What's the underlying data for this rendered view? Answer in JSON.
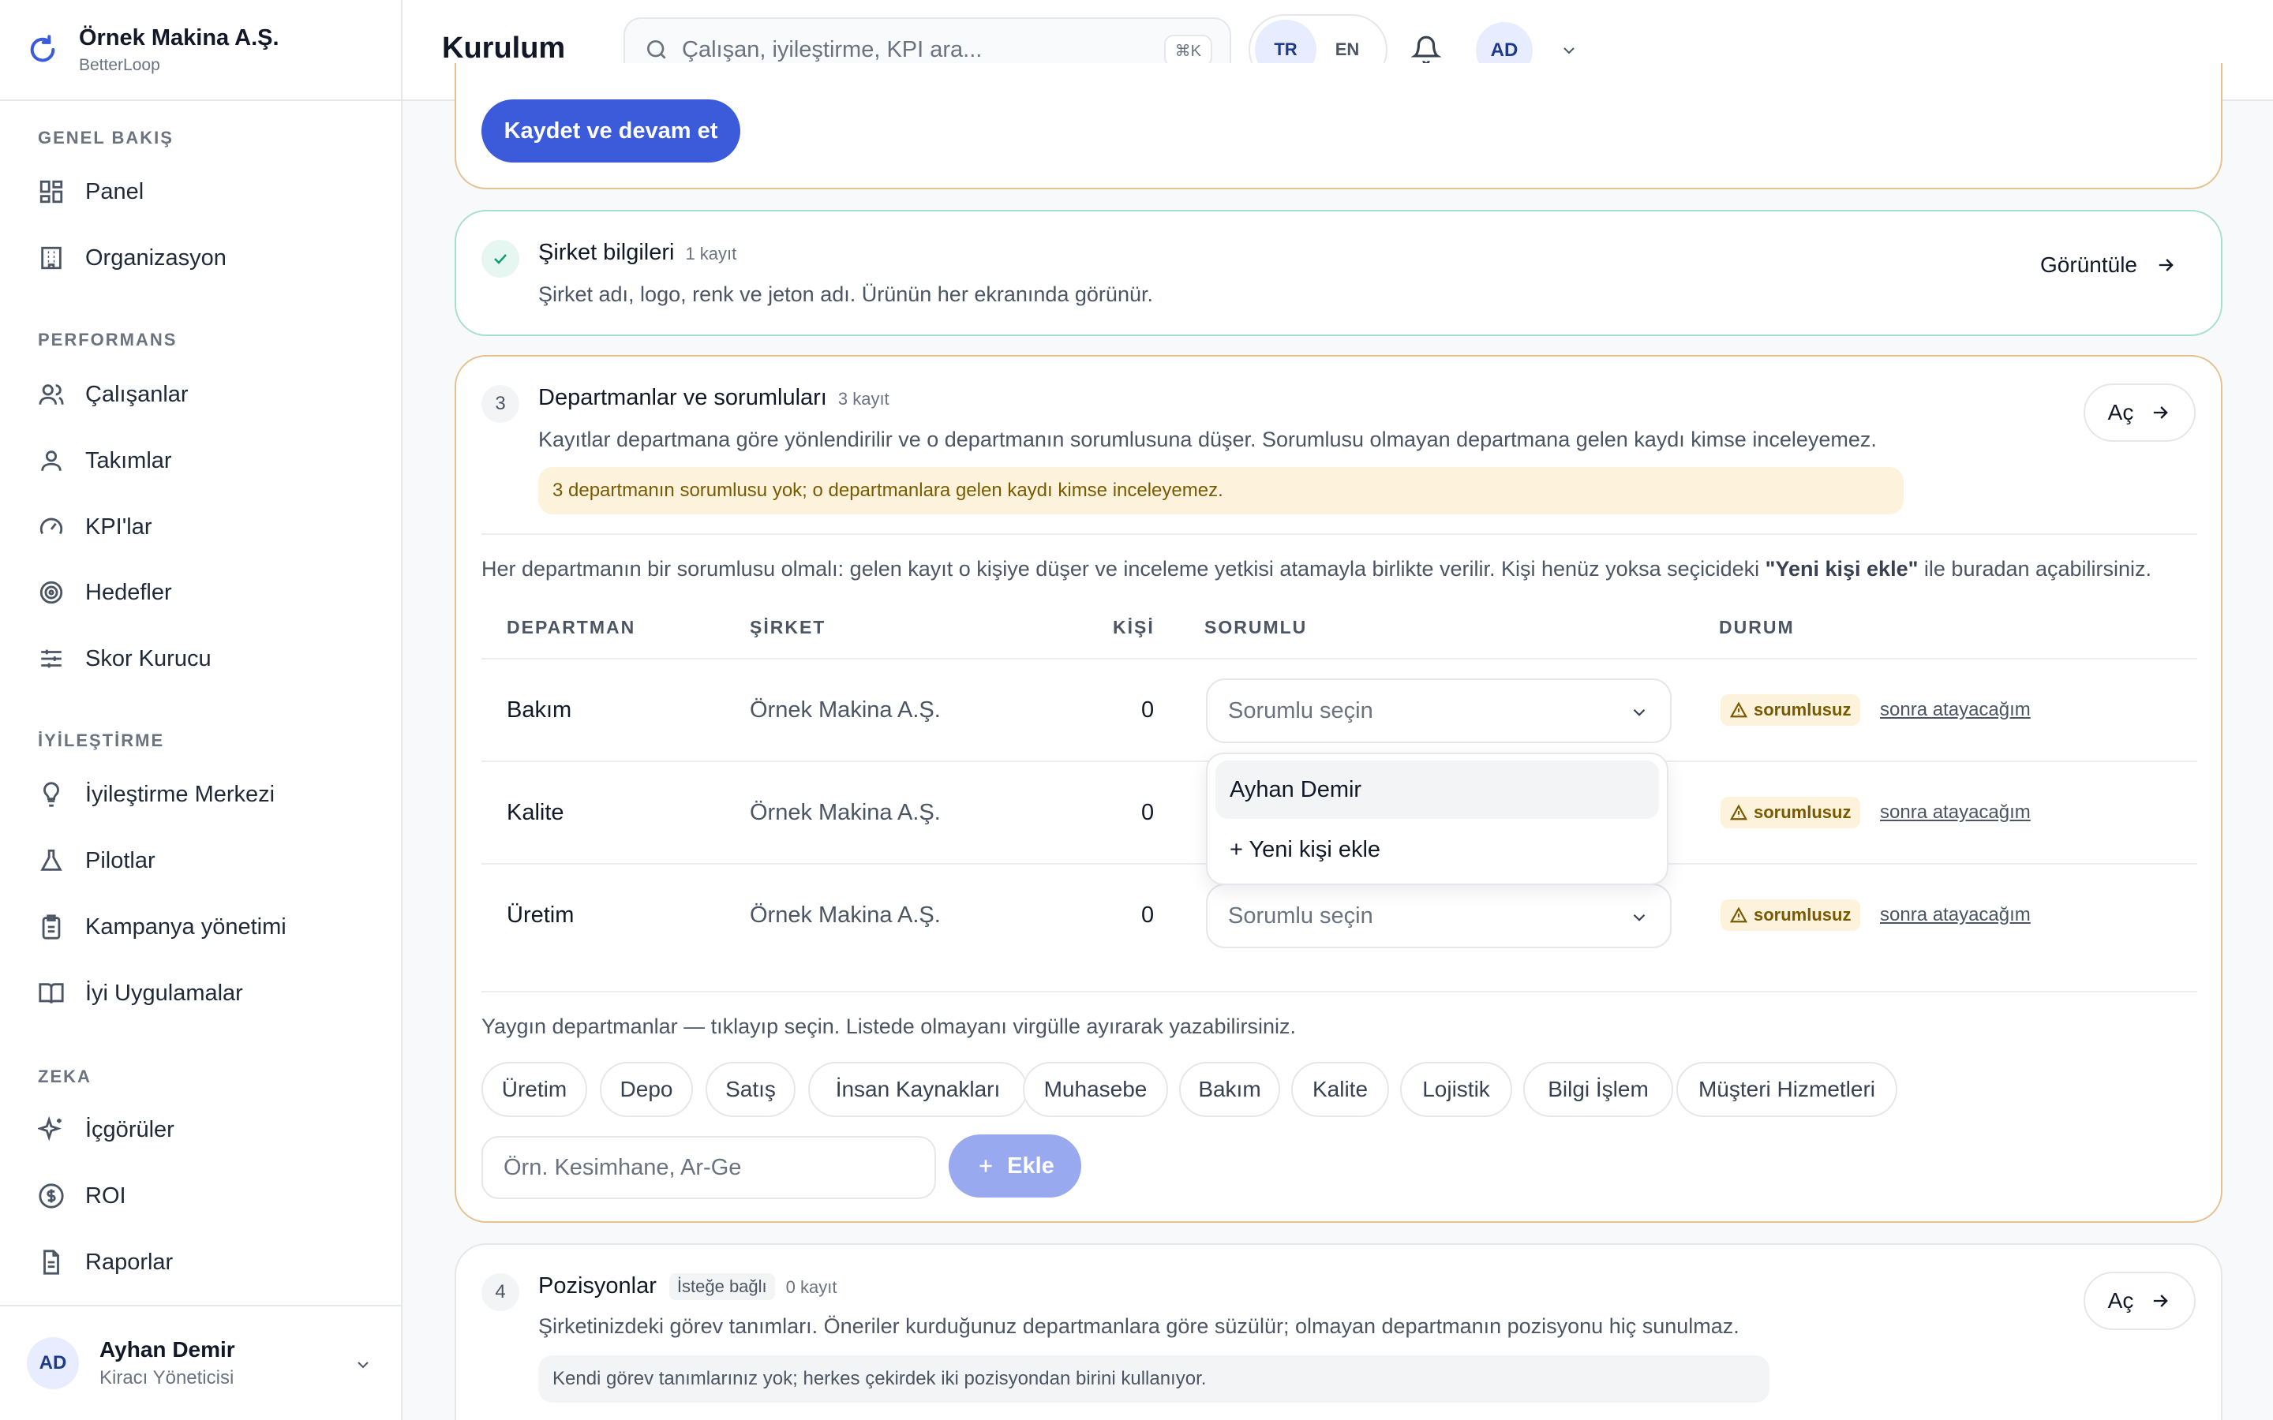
{
  "brand": {
    "name": "Örnek Makina A.Ş.",
    "sub": "BetterLoop"
  },
  "sidebar": {
    "sections": [
      {
        "title": "GENEL BAKIŞ",
        "items": [
          {
            "label": "Panel",
            "icon": "grid-icon"
          },
          {
            "label": "Organizasyon",
            "icon": "building-icon"
          }
        ]
      },
      {
        "title": "PERFORMANS",
        "items": [
          {
            "label": "Çalışanlar",
            "icon": "users-icon"
          },
          {
            "label": "Takımlar",
            "icon": "team-icon"
          },
          {
            "label": "KPI'lar",
            "icon": "gauge-icon"
          },
          {
            "label": "Hedefler",
            "icon": "target-icon"
          },
          {
            "label": "Skor Kurucu",
            "icon": "sliders-icon"
          }
        ]
      },
      {
        "title": "İYİLEŞTİRME",
        "items": [
          {
            "label": "İyileştirme Merkezi",
            "icon": "lightbulb-icon"
          },
          {
            "label": "Pilotlar",
            "icon": "flask-icon"
          },
          {
            "label": "Kampanya yönetimi",
            "icon": "clipboard-icon"
          },
          {
            "label": "İyi Uygulamalar",
            "icon": "book-icon"
          }
        ]
      },
      {
        "title": "ZEKA",
        "items": [
          {
            "label": "İçgörüler",
            "icon": "sparkles-icon"
          },
          {
            "label": "ROI",
            "icon": "dollar-icon"
          },
          {
            "label": "Raporlar",
            "icon": "file-icon"
          }
        ]
      }
    ]
  },
  "user": {
    "initials": "AD",
    "name": "Ayhan Demir",
    "role": "Kiracı Yöneticisi"
  },
  "topbar": {
    "title": "Kurulum",
    "search_placeholder": "Çalışan, iyileştirme, KPI ara...",
    "shortcut": "⌘K",
    "lang_tr": "TR",
    "lang_en": "EN",
    "avatar": "AD"
  },
  "card_top": {
    "save_button": "Kaydet ve devam et"
  },
  "card_company": {
    "title": "Şirket bilgileri",
    "count": "1 kayıt",
    "desc": "Şirket adı, logo, renk ve jeton adı. Ürünün her ekranında görünür.",
    "view_button": "Görüntüle"
  },
  "card_departments": {
    "step": "3",
    "title": "Departmanlar ve sorumluları",
    "count": "3 kayıt",
    "desc": "Kayıtlar departmana göre yönlendirilir ve o departmanın sorumlusuna düşer. Sorumlusu olmayan departmana gelen kaydı kimse inceleyemez.",
    "warning": "3 departmanın sorumlusu yok; o departmanlara gelen kaydı kimse inceleyemez.",
    "open_button": "Aç",
    "help_pre": "Her departmanın bir sorumlusu olmalı: gelen kayıt o kişiye düşer ve inceleme yetkisi atamayla birlikte verilir. Kişi henüz yoksa seçicideki ",
    "help_bold": "\"Yeni kişi ekle\"",
    "help_post": " ile buradan açabilirsiniz.",
    "columns": [
      "DEPARTMAN",
      "ŞİRKET",
      "KİŞİ",
      "SORUMLU",
      "DURUM"
    ],
    "rows": [
      {
        "dept": "Bakım",
        "company": "Örnek Makina A.Ş.",
        "people": "0",
        "select": "Sorumlu seçin",
        "status": "sorumlusuz",
        "later": "sonra atayacağım"
      },
      {
        "dept": "Kalite",
        "company": "Örnek Makina A.Ş.",
        "people": "0",
        "select": "Sorumlu seçin",
        "status": "sorumlusuz",
        "later": "sonra atayacağım"
      },
      {
        "dept": "Üretim",
        "company": "Örnek Makina A.Ş.",
        "people": "0",
        "select": "Sorumlu seçin",
        "status": "sorumlusuz",
        "later": "sonra atayacağım"
      }
    ],
    "dropdown": [
      "Ayhan Demir",
      "+ Yeni kişi ekle"
    ],
    "common_hint": "Yaygın departmanlar — tıklayıp seçin. Listede olmayanı virgülle ayırarak yazabilirsiniz.",
    "chips": [
      "Üretim",
      "Depo",
      "Satış",
      "İnsan Kaynakları",
      "Muhasebe",
      "Bakım",
      "Kalite",
      "Lojistik",
      "Bilgi İşlem",
      "Müşteri Hizmetleri"
    ],
    "input_placeholder": "Örn. Kesimhane, Ar-Ge",
    "add_button": "Ekle"
  },
  "card_positions": {
    "step": "4",
    "title": "Pozisyonlar",
    "tag": "İsteğe bağlı",
    "count": "0 kayıt",
    "desc": "Şirketinizdeki görev tanımları. Öneriler kurduğunuz departmanlara göre süzülür; olmayan departmanın pozisyonu hiç sunulmaz.",
    "info": "Kendi görev tanımlarınız yok; herkes çekirdek iki pozisyondan birini kullanıyor.",
    "open_button": "Aç"
  },
  "colors": {
    "primary": "#3b5bdb",
    "warning_bg": "#fdf3dc",
    "card_border": "#e5c28f",
    "done_border": "#a7dfd0"
  }
}
